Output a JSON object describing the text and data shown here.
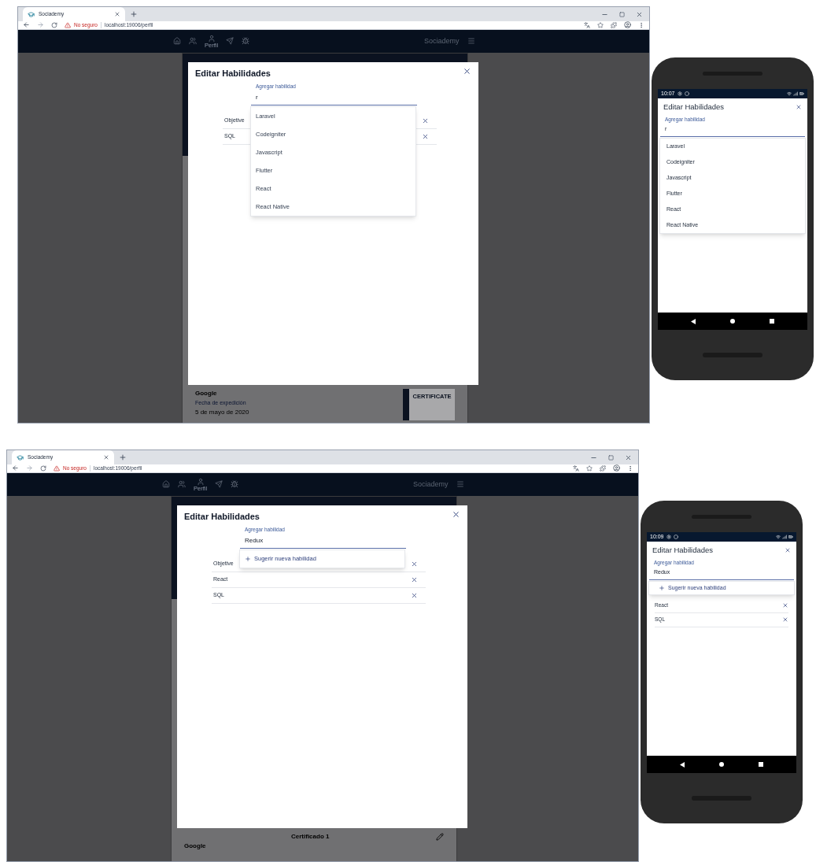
{
  "scenes": [
    {
      "browser": {
        "tab_title": "Sociademy",
        "security": "No seguro",
        "url": "localhost:19006/perfil",
        "nav_label": "Perfil",
        "app_name": "Sociademy"
      },
      "card": {
        "issuer": "Google",
        "date_label": "Fecha de expedición",
        "date": "5 de mayo de 2020",
        "thumbnail_text": "CERTIFICATE"
      },
      "dialog": {
        "title": "Editar Habilidades",
        "field_label": "Agregar habilidad",
        "field_value": "r",
        "skills": [
          "Objetive",
          "SQL"
        ],
        "dropdown": {
          "kind": "options",
          "items": [
            "Laravel",
            "Codeigniter",
            "Javascript",
            "Flutter",
            "React",
            "React Native"
          ]
        }
      },
      "phone": {
        "time": "10:07",
        "dialog": {
          "title": "Editar Habilidades",
          "field_label": "Agregar habilidad",
          "field_value": "r",
          "dropdown": {
            "kind": "options",
            "items": [
              "Laravel",
              "Codeigniter",
              "Javascript",
              "Flutter",
              "React",
              "React Native"
            ]
          }
        }
      }
    },
    {
      "browser": {
        "tab_title": "Sociademy",
        "security": "No seguro",
        "url": "localhost:19006/perfil",
        "nav_label": "Perfil",
        "app_name": "Sociademy"
      },
      "card": {
        "heading": "Certificado 1",
        "issuer": "Google"
      },
      "dialog": {
        "title": "Editar Habilidades",
        "field_label": "Agregar habilidad",
        "field_value": "Redux",
        "skills": [
          "Objetive",
          "React",
          "SQL"
        ],
        "dropdown": {
          "kind": "suggest",
          "label": "Sugerir nueva habilidad"
        }
      },
      "phone": {
        "time": "10:09",
        "dialog": {
          "title": "Editar Habilidades",
          "field_label": "Agregar habilidad",
          "field_value": "Redux",
          "skills": [
            "React",
            "SQL"
          ],
          "dropdown": {
            "kind": "suggest",
            "label": "Sugerir nueva habilidad"
          }
        }
      }
    }
  ]
}
